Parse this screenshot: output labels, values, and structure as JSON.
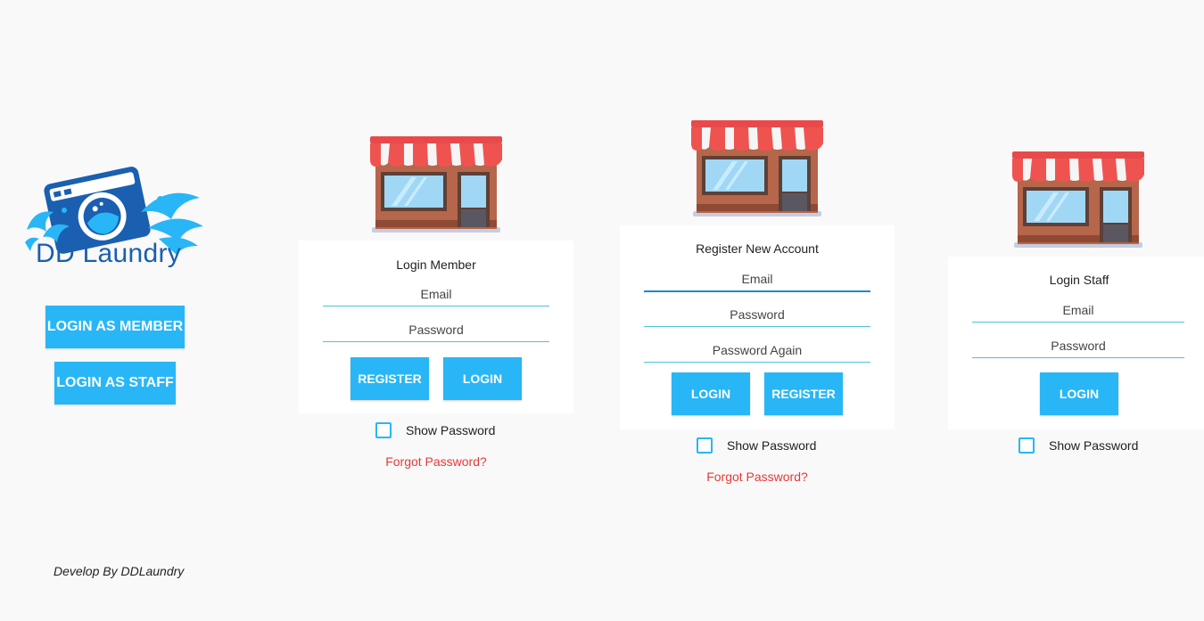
{
  "brand": {
    "name": "DD Laundry",
    "logo_icon": "washing-machine-splash-logo"
  },
  "sidebar": {
    "login_member_label": "LOGIN AS MEMBER",
    "login_staff_label": "LOGIN AS STAFF"
  },
  "footer": {
    "text": "Develop By DDLaundry"
  },
  "icons": {
    "store": "storefront-icon",
    "checkbox": "checkbox-icon"
  },
  "colors": {
    "accent": "#29b6f6",
    "link_red": "#e53935",
    "background": "#f9f9f9",
    "brand_blue": "#1a5fb0"
  },
  "member_login": {
    "title": "Login Member",
    "email_placeholder": "Email",
    "password_placeholder": "Password",
    "register_label": "REGISTER",
    "login_label": "LOGIN",
    "show_password_label": "Show Password",
    "forgot_label": "Forgot Password?"
  },
  "register": {
    "title": "Register New Account",
    "email_placeholder": "Email",
    "password_placeholder": "Password",
    "password_again_placeholder": "Password Again",
    "login_label": "LOGIN",
    "register_label": "REGISTER",
    "show_password_label": "Show Password",
    "forgot_label": "Forgot Password?"
  },
  "staff_login": {
    "title": "Login Staff",
    "email_placeholder": "Email",
    "password_placeholder": "Password",
    "login_label": "LOGIN",
    "show_password_label": "Show Password"
  }
}
